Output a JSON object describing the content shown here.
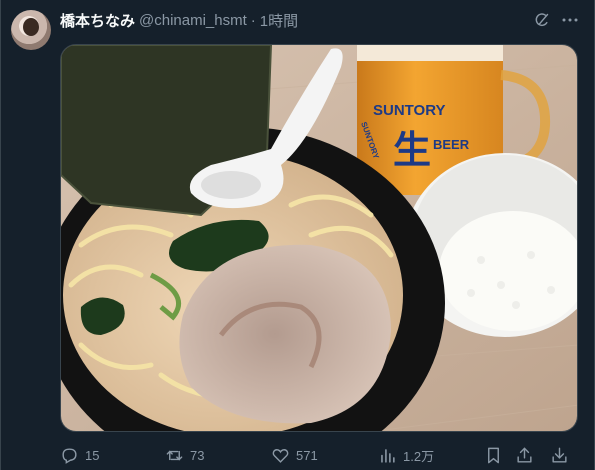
{
  "author": {
    "display_name": "橋本ちなみ",
    "handle": "@chinami_hsmt",
    "separator": "·",
    "time": "1時間"
  },
  "media": {
    "beer_brand": "SUNTORY",
    "beer_label_big": "生",
    "beer_label_side": "SUNTORY",
    "beer_label_beer": "BEER"
  },
  "stats": {
    "replies": "15",
    "reposts": "73",
    "likes": "571",
    "views": "1.2万"
  },
  "icons": {
    "reply": "reply-icon",
    "repost": "repost-icon",
    "like": "heart-icon",
    "views": "views-icon",
    "bookmark": "bookmark-icon",
    "share": "share-icon",
    "grok": "grok-icon",
    "more": "more-icon"
  },
  "colors": {
    "background": "#15202b",
    "text": "#f7f9f9",
    "muted": "#8b98a5",
    "border": "#38444d"
  }
}
